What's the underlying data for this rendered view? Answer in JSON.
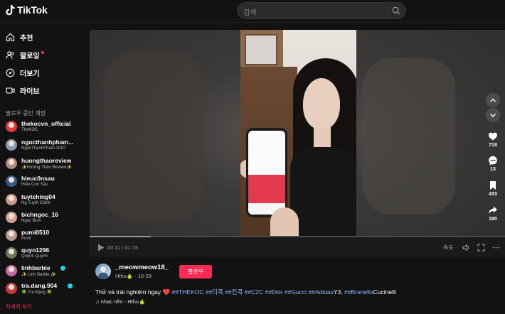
{
  "app": {
    "logo_text": "TikTok"
  },
  "search": {
    "placeholder": "검색"
  },
  "sidebar": {
    "nav": [
      {
        "label": "추천",
        "icon": "home-icon"
      },
      {
        "label": "팔로잉",
        "icon": "following-icon"
      },
      {
        "label": "더보기",
        "icon": "explore-icon"
      },
      {
        "label": "라이브",
        "icon": "live-icon"
      }
    ],
    "following_title": "팔로우 중인 계정",
    "accounts": [
      {
        "name": "thekocvn_official",
        "sub": "TheKOC",
        "verified": false,
        "color": "#e23b3b"
      },
      {
        "name": "ngocthanhpham...",
        "sub": "NgocThanhPham.1010",
        "verified": false,
        "color": "#8a9bb5"
      },
      {
        "name": "huongthaoreview",
        "sub": "✨Hương Thảo Review✨",
        "verified": false,
        "color": "#b08a7a"
      },
      {
        "name": "hieuc0nsau",
        "sub": "Hiếu Con Sâu",
        "verified": false,
        "color": "#3a5a8a"
      },
      {
        "name": "tuytching04",
        "sub": "Ng Tuyết Chinh",
        "verified": false,
        "color": "#c79a8a"
      },
      {
        "name": "bichngoc_16",
        "sub": "Ngọc Bích",
        "verified": false,
        "color": "#d0a090"
      },
      {
        "name": "pumi0510",
        "sub": "Pumi",
        "verified": false,
        "color": "#b59a90"
      },
      {
        "name": "quyn1296",
        "sub": "Quỳnh Quỳnh",
        "verified": false,
        "color": "#6a7a5a"
      },
      {
        "name": "linhbarbie",
        "sub": "✨ Linh Barbie ✨",
        "verified": true,
        "color": "#c46aa0"
      },
      {
        "name": "tra.dang.904",
        "sub": "🍀 Trà Đặng 🍀",
        "verified": true,
        "color": "#c23a3a"
      }
    ],
    "see_more": "자세히 보기"
  },
  "video": {
    "time": "00:11 / 01:15",
    "progress_fraction": 0.147,
    "speed_label": "속도",
    "actions": [
      {
        "name": "like",
        "count": "718"
      },
      {
        "name": "comment",
        "count": "13"
      },
      {
        "name": "save",
        "count": "433"
      },
      {
        "name": "share",
        "count": "190"
      }
    ]
  },
  "post": {
    "author": "_meowmeow18_",
    "author_sub": "Hthu🍐 · 10-29",
    "follow_label": "팔로우",
    "caption_text": "Thử và trải nghiệm ngay",
    "caption_heart": "❤️",
    "hashtags": "##THEKOC ##더콕 ##킨콕 ##C2C ##Dior ##Gucci ##Adidas",
    "caption_tail": "Y3, ",
    "hashtag_last": "##Brunello",
    "caption_end": "Cucinelli",
    "music": "♫ nhạc nền - Hthu🍐"
  },
  "colors": {
    "brand": "#fe2c55",
    "verified": "#20d5ec"
  }
}
